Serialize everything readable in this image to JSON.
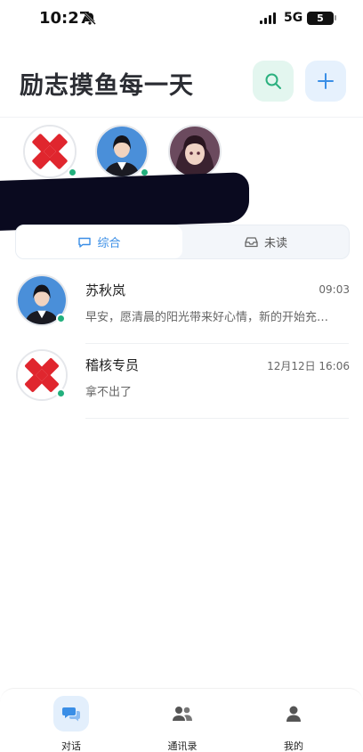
{
  "status": {
    "time": "10:27",
    "network": "5G",
    "battery": "5"
  },
  "header": {
    "title": "励志摸鱼每一天"
  },
  "tabs": [
    {
      "label": "综合",
      "active": true
    },
    {
      "label": "未读",
      "active": false
    }
  ],
  "conversations": [
    {
      "name": "苏秋岚",
      "time": "09:03",
      "message": "早安，愿清晨的阳光带来好心情，新的开始充…",
      "online": true
    },
    {
      "name": "稽核专员",
      "time": "12月12日 16:06",
      "message": "拿不出了",
      "online": true
    }
  ],
  "nav": [
    {
      "label": "对话",
      "icon": "chat-bubbles-icon",
      "active": true
    },
    {
      "label": "通讯录",
      "icon": "contacts-icon",
      "active": false
    },
    {
      "label": "我的",
      "icon": "person-icon",
      "active": false
    }
  ],
  "colors": {
    "accent": "#3a8ee6",
    "online": "#22b07d",
    "logo_red": "#e0262e"
  }
}
